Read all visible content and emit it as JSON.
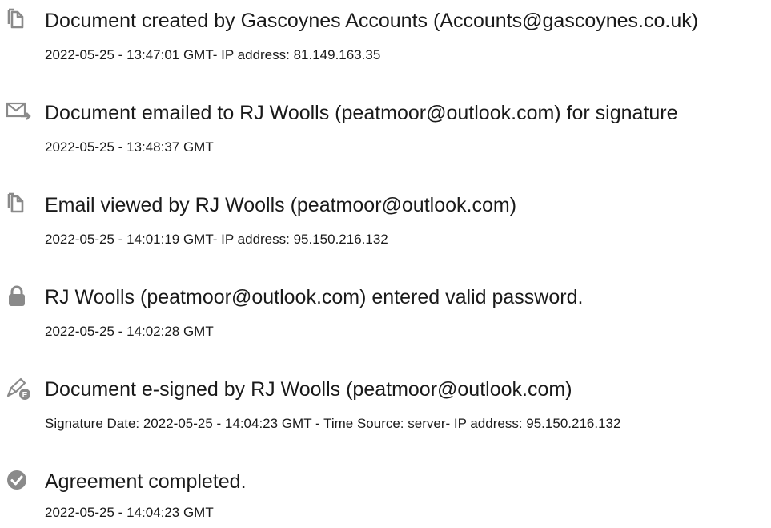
{
  "events": [
    {
      "icon": "document-icon",
      "title": "Document created by Gascoynes Accounts (Accounts@gascoynes.co.uk)",
      "detail": "2022-05-25 - 13:47:01 GMT- IP address: 81.149.163.35"
    },
    {
      "icon": "email-send-icon",
      "title": "Document emailed to RJ Woolls (peatmoor@outlook.com) for signature",
      "detail": "2022-05-25 - 13:48:37 GMT"
    },
    {
      "icon": "document-icon",
      "title": "Email viewed by RJ Woolls (peatmoor@outlook.com)",
      "detail": "2022-05-25 - 14:01:19 GMT- IP address: 95.150.216.132"
    },
    {
      "icon": "lock-icon",
      "title": "RJ Woolls (peatmoor@outlook.com) entered valid password.",
      "detail": "2022-05-25 - 14:02:28 GMT"
    },
    {
      "icon": "esign-pen-icon",
      "title": "Document e-signed by RJ Woolls (peatmoor@outlook.com)",
      "detail": "Signature Date: 2022-05-25 - 14:04:23 GMT - Time Source: server- IP address: 95.150.216.132"
    },
    {
      "icon": "checkmark-circle-icon",
      "title": "Agreement completed.",
      "detail": "2022-05-25 - 14:04:23 GMT"
    }
  ],
  "icon_color": "#8a8a8a",
  "icon_letter": "E"
}
